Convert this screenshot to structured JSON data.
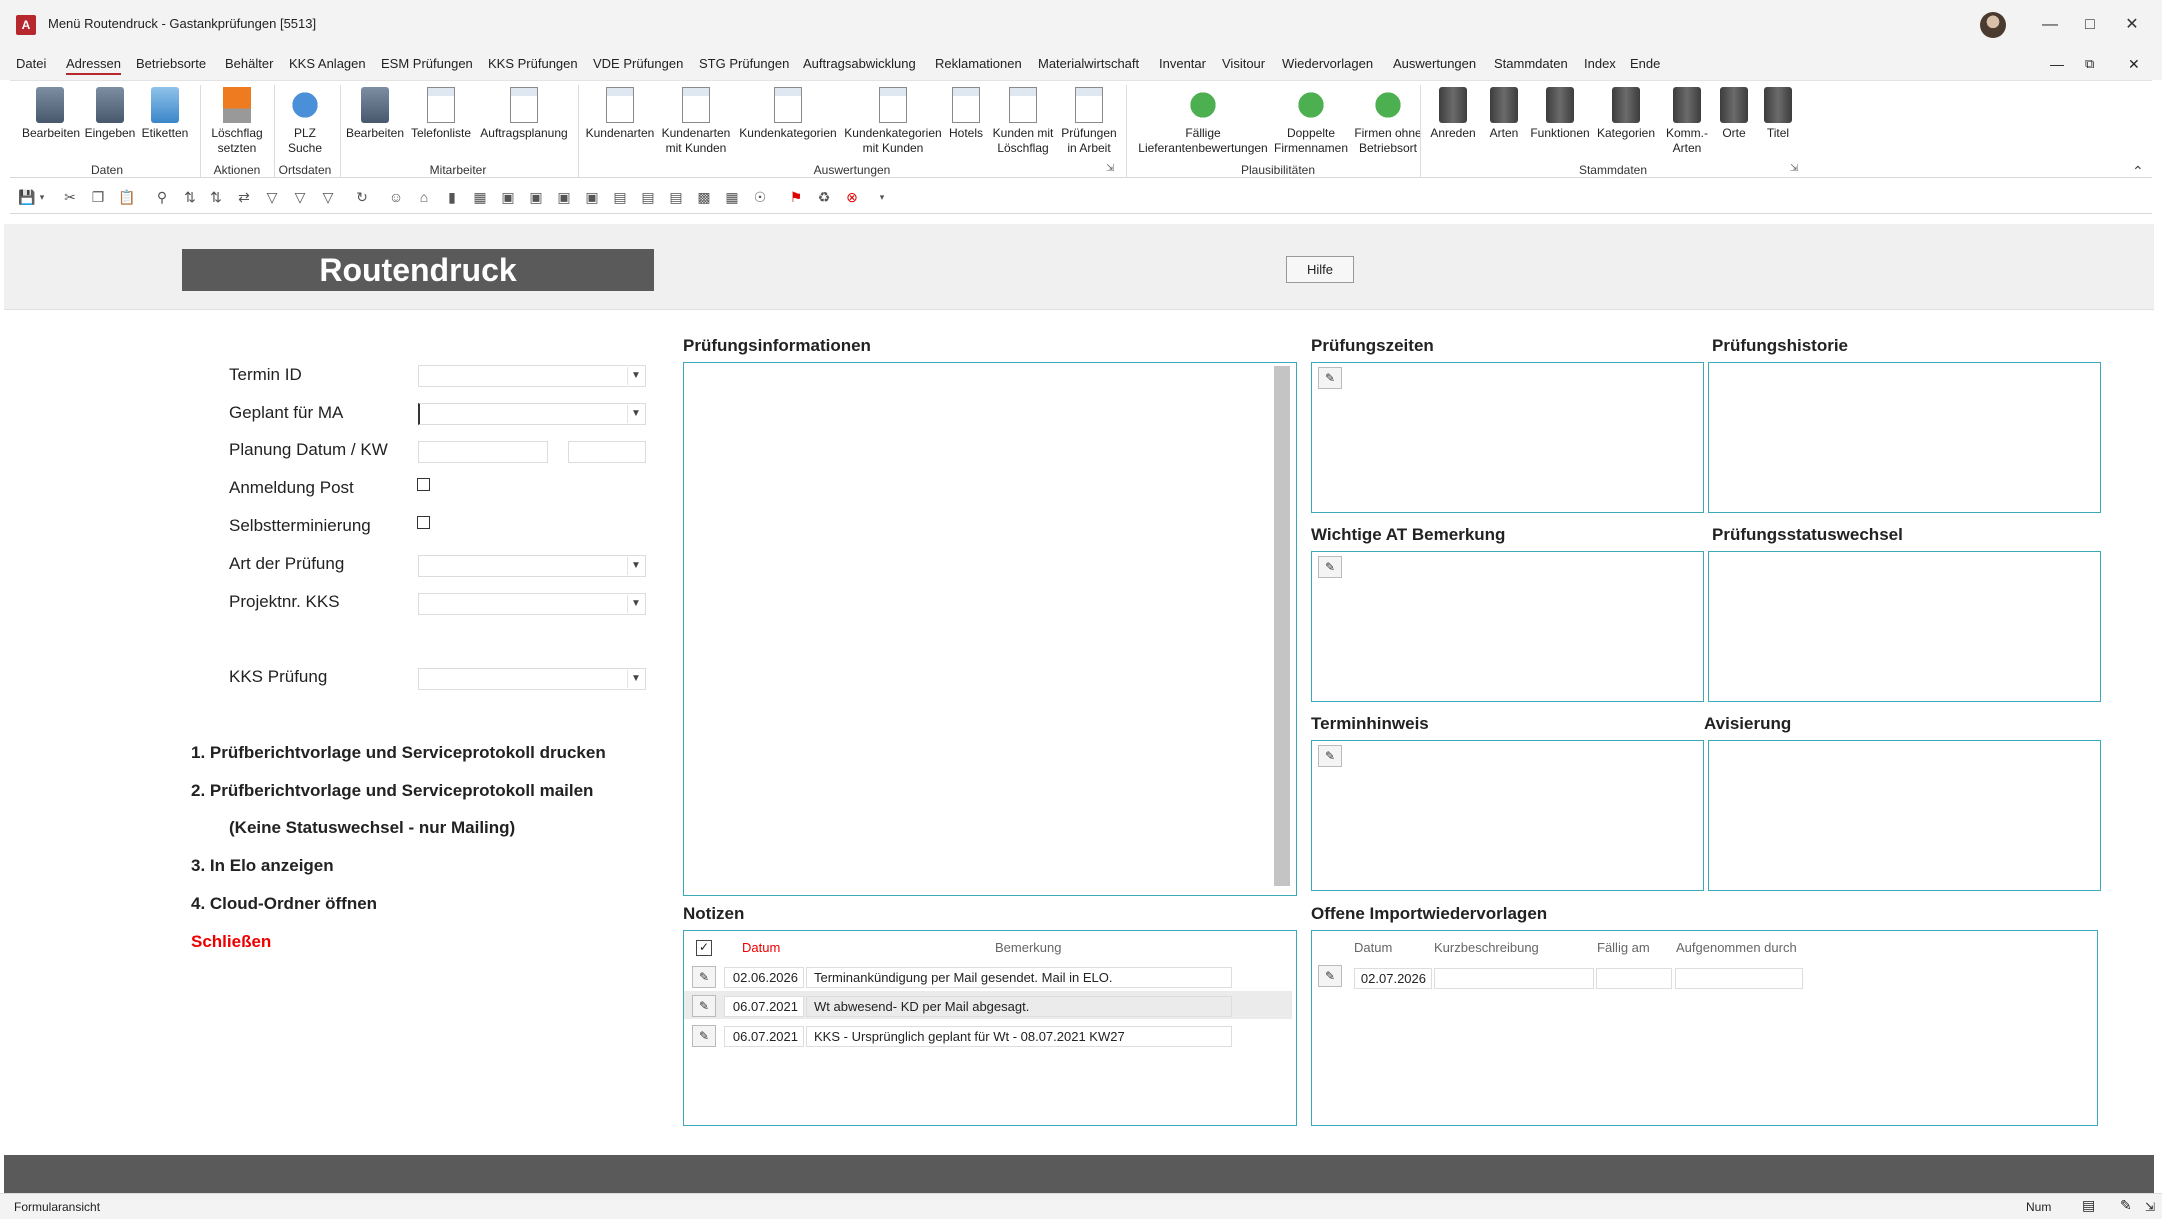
{
  "window": {
    "title": "Menü Routendruck - Gastankprüfungen [5513]"
  },
  "menu": [
    "Datei",
    "Adressen",
    "Betriebsorte",
    "Behälter",
    "KKS Anlagen",
    "ESM Prüfungen",
    "KKS Prüfungen",
    "VDE Prüfungen",
    "STG Prüfungen",
    "Auftragsabwicklung",
    "Reklamationen",
    "Materialwirtschaft",
    "Inventar",
    "Visitour",
    "Wiedervorlagen",
    "Auswertungen",
    "Stammdaten",
    "Index",
    "Ende"
  ],
  "ribbon": {
    "daten": {
      "label": "Daten",
      "buttons": [
        "Bearbeiten",
        "Eingeben",
        "Etiketten"
      ]
    },
    "aktionen": {
      "label": "Aktionen",
      "b1": "Löschflag",
      "b1b": "setzten"
    },
    "ortsdaten": {
      "label": "Ortsdaten",
      "b1": "PLZ",
      "b1b": "Suche"
    },
    "mitarbeiter": {
      "label": "Mitarbeiter",
      "buttons": [
        "Bearbeiten",
        "Telefonliste",
        "Auftragsplanung"
      ]
    },
    "auswertungen": {
      "label": "Auswertungen",
      "buttons": [
        [
          "Kundenarten",
          ""
        ],
        [
          "Kundenarten",
          "mit Kunden"
        ],
        [
          "Kundenkategorien",
          ""
        ],
        [
          "Kundenkategorien",
          "mit Kunden"
        ],
        [
          "Hotels",
          ""
        ],
        [
          "Kunden mit",
          "Löschflag"
        ],
        [
          "Prüfungen",
          "in Arbeit"
        ]
      ]
    },
    "plaus": {
      "label": "Plausibilitäten",
      "buttons": [
        [
          "Fällige",
          "Lieferantenbewertungen"
        ],
        [
          "Doppelte",
          "Firmennamen"
        ],
        [
          "Firmen ohne",
          "Betriebsort"
        ]
      ]
    },
    "stamm": {
      "label": "Stammdaten",
      "buttons": [
        [
          "Anreden",
          ""
        ],
        [
          "Arten",
          ""
        ],
        [
          "Funktionen",
          ""
        ],
        [
          "Kategorien",
          ""
        ],
        [
          "Komm.-",
          "Arten"
        ],
        [
          "Orte",
          ""
        ],
        [
          "Titel",
          ""
        ]
      ]
    }
  },
  "header": {
    "title": "Routendruck",
    "help": "Hilfe"
  },
  "fields": {
    "termin_id": "Termin ID",
    "geplant": "Geplant für MA",
    "planung": "Planung Datum / KW",
    "anmeldung": "Anmeldung Post",
    "selbst": "Selbstterminierung",
    "art": "Art der Prüfung",
    "projekt": "Projektnr. KKS",
    "kks": "KKS Prüfung"
  },
  "actions": {
    "a1": "1. Prüfberichtvorlage und Serviceprotokoll drucken",
    "a2": "2. Prüfberichtvorlage und Serviceprotokoll mailen",
    "a2b": "(Keine Statuswechsel - nur Mailing)",
    "a3": "3. In Elo anzeigen",
    "a4": "4. Cloud-Ordner öffnen",
    "close": "Schließen"
  },
  "sections": {
    "info": "Prüfungsinformationen",
    "zeiten": "Prüfungszeiten",
    "historie": "Prüfungshistorie",
    "at": "Wichtige AT Bemerkung",
    "status": "Prüfungsstatuswechsel",
    "termin": "Terminhinweis",
    "avis": "Avisierung",
    "notizen": "Notizen",
    "import": "Offene Importwiedervorlagen"
  },
  "notes": {
    "col_date": "Datum",
    "col_remark": "Bemerkung",
    "rows": [
      {
        "date": "02.06.2026",
        "text": "Terminankündigung per Mail gesendet. Mail in ELO."
      },
      {
        "date": "06.07.2021",
        "text": "Wt abwesend- KD per Mail abgesagt."
      },
      {
        "date": "06.07.2021",
        "text": "KKS - Ursprünglich geplant für Wt - 08.07.2021 KW27"
      }
    ]
  },
  "imports": {
    "cols": [
      "Datum",
      "Kurzbeschreibung",
      "Fällig am",
      "Aufgenommen durch"
    ],
    "rows": [
      {
        "date": "02.07.2026"
      }
    ]
  },
  "status": {
    "left": "Formularansicht",
    "num": "Num"
  }
}
